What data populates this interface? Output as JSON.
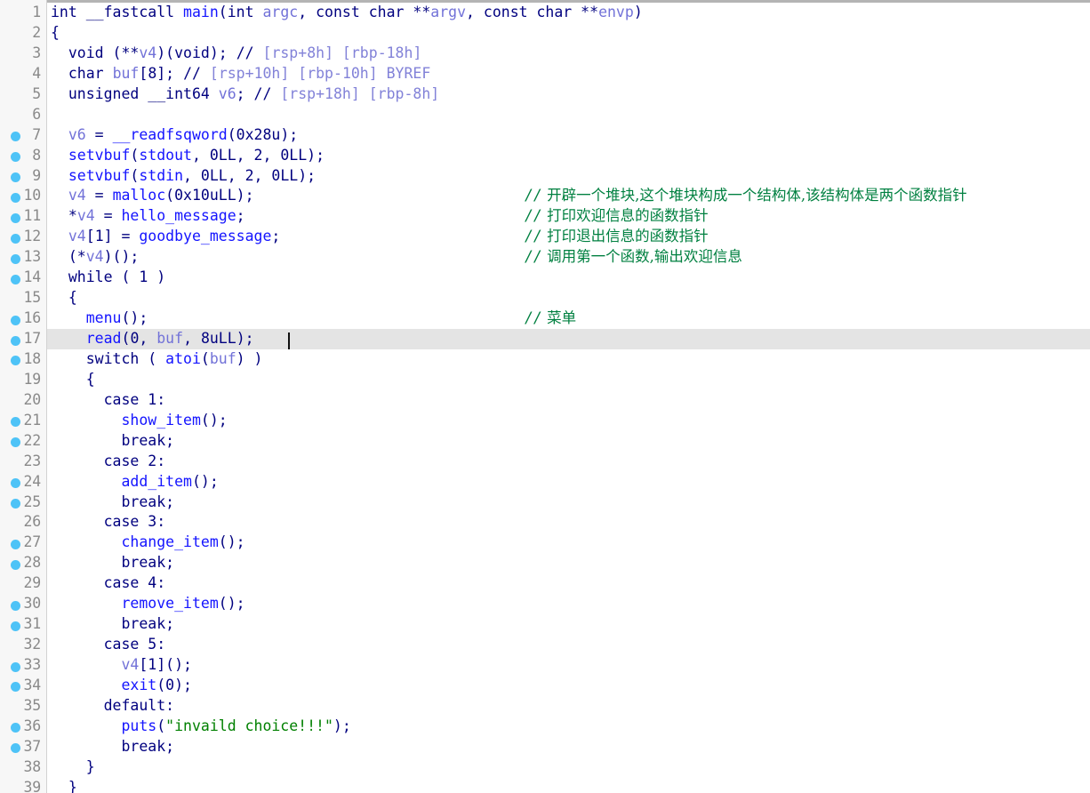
{
  "view": {
    "type": "ida-pseudocode-view",
    "language": "C",
    "gutter_bg": "#f7f7f7",
    "code_bg": "#ffffff",
    "highlight_bg": "#e4e4e4",
    "breakpoint_color": "#4ec3f7",
    "keyword_color": "#00007f",
    "function_color": "#1414ff",
    "variable_color": "#7272d8",
    "string_color": "#008000",
    "comment_color": "#008040",
    "stackvar_color": "#8282d8",
    "linenum_color": "#8a8a8a",
    "highlighted_line": 17,
    "caret_line": 17
  },
  "lines": [
    {
      "n": "1",
      "bp": false,
      "code": "int __fastcall main(int argc, const char **argv, const char **envp)"
    },
    {
      "n": "2",
      "bp": false,
      "code": "{"
    },
    {
      "n": "3",
      "bp": false,
      "code": "  void (**v4)(void); // [rsp+8h] [rbp-18h]"
    },
    {
      "n": "4",
      "bp": false,
      "code": "  char buf[8]; // [rsp+10h] [rbp-10h] BYREF"
    },
    {
      "n": "5",
      "bp": false,
      "code": "  unsigned __int64 v6; // [rsp+18h] [rbp-8h]"
    },
    {
      "n": "6",
      "bp": false,
      "code": ""
    },
    {
      "n": "7",
      "bp": true,
      "code": "  v6 = __readfsqword(0x28u);"
    },
    {
      "n": "8",
      "bp": true,
      "code": "  setvbuf(stdout, 0LL, 2, 0LL);"
    },
    {
      "n": "9",
      "bp": true,
      "code": "  setvbuf(stdin, 0LL, 2, 0LL);"
    },
    {
      "n": "10",
      "bp": true,
      "code": "  v4 = malloc(0x10uLL);"
    },
    {
      "n": "11",
      "bp": true,
      "code": "  *v4 = hello_message;"
    },
    {
      "n": "12",
      "bp": true,
      "code": "  v4[1] = goodbye_message;"
    },
    {
      "n": "13",
      "bp": true,
      "code": "  (*v4)();"
    },
    {
      "n": "14",
      "bp": true,
      "code": "  while ( 1 )"
    },
    {
      "n": "15",
      "bp": false,
      "code": "  {"
    },
    {
      "n": "16",
      "bp": true,
      "code": "    menu();"
    },
    {
      "n": "17",
      "bp": true,
      "code": "    read(0, buf, 8uLL);"
    },
    {
      "n": "18",
      "bp": true,
      "code": "    switch ( atoi(buf) )"
    },
    {
      "n": "19",
      "bp": false,
      "code": "    {"
    },
    {
      "n": "20",
      "bp": false,
      "code": "      case 1:"
    },
    {
      "n": "21",
      "bp": true,
      "code": "        show_item();"
    },
    {
      "n": "22",
      "bp": true,
      "code": "        break;"
    },
    {
      "n": "23",
      "bp": false,
      "code": "      case 2:"
    },
    {
      "n": "24",
      "bp": true,
      "code": "        add_item();"
    },
    {
      "n": "25",
      "bp": true,
      "code": "        break;"
    },
    {
      "n": "26",
      "bp": false,
      "code": "      case 3:"
    },
    {
      "n": "27",
      "bp": true,
      "code": "        change_item();"
    },
    {
      "n": "28",
      "bp": true,
      "code": "        break;"
    },
    {
      "n": "29",
      "bp": false,
      "code": "      case 4:"
    },
    {
      "n": "30",
      "bp": true,
      "code": "        remove_item();"
    },
    {
      "n": "31",
      "bp": true,
      "code": "        break;"
    },
    {
      "n": "32",
      "bp": false,
      "code": "      case 5:"
    },
    {
      "n": "33",
      "bp": true,
      "code": "        v4[1]();"
    },
    {
      "n": "34",
      "bp": true,
      "code": "        exit(0);"
    },
    {
      "n": "35",
      "bp": false,
      "code": "      default:"
    },
    {
      "n": "36",
      "bp": true,
      "code": "        puts(\"invaild choice!!!\");"
    },
    {
      "n": "37",
      "bp": true,
      "code": "        break;"
    },
    {
      "n": "38",
      "bp": false,
      "code": "    }"
    },
    {
      "n": "39",
      "bp": false,
      "code": "  }"
    }
  ],
  "user_comments": [
    {
      "line": 10,
      "marker": "//",
      "text": "开辟一个堆块,这个堆块构成一个结构体,该结构体是两个函数指针"
    },
    {
      "line": 11,
      "marker": "//",
      "text": "打印欢迎信息的函数指针"
    },
    {
      "line": 12,
      "marker": "//",
      "text": "打印退出信息的函数指针"
    },
    {
      "line": 13,
      "marker": "//",
      "text": "调用第一个函数,输出欢迎信息"
    },
    {
      "line": 16,
      "marker": "//",
      "text": "菜单"
    }
  ]
}
